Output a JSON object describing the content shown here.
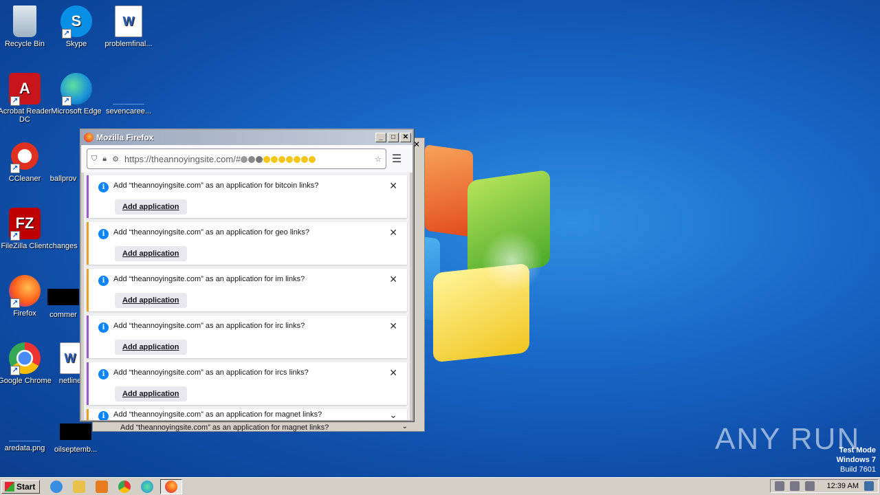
{
  "desktop": {
    "icons": [
      {
        "label": "Recycle Bin"
      },
      {
        "label": "Skype"
      },
      {
        "label": "problemfinal..."
      },
      {
        "label": "Acrobat Reader DC"
      },
      {
        "label": "Microsoft Edge"
      },
      {
        "label": "sevencaree..."
      },
      {
        "label": "CCleaner"
      },
      {
        "label": "ballprov"
      },
      {
        "label": "FileZilla Client"
      },
      {
        "label": "changes"
      },
      {
        "label": "Firefox"
      },
      {
        "label": "commer"
      },
      {
        "label": "Google Chrome"
      },
      {
        "label": "netline"
      },
      {
        "label": "aredata.png"
      },
      {
        "label": "oilseptemb..."
      }
    ]
  },
  "window": {
    "title": "Mozilla Firefox",
    "url": "https://theannoyingsite.com/#",
    "notifications": [
      {
        "message": "Add “theannoyingsite.com” as an application for bitcoin links?",
        "button": "Add application"
      },
      {
        "message": "Add “theannoyingsite.com” as an application for geo links?",
        "button": "Add application"
      },
      {
        "message": "Add “theannoyingsite.com” as an application for im links?",
        "button": "Add application"
      },
      {
        "message": "Add “theannoyingsite.com” as an application for irc links?",
        "button": "Add application"
      },
      {
        "message": "Add “theannoyingsite.com” as an application for ircs links?",
        "button": "Add application"
      },
      {
        "message": "Add “theannoyingsite.com” as an application for magnet links?"
      }
    ],
    "back_window_partial": "Add “theannoyingsite.com” as an application for magnet links?"
  },
  "taskbar": {
    "start_label": "Start",
    "clock": "12:39 AM"
  },
  "watermark": {
    "line1": "Test Mode",
    "line2": "Windows 7",
    "line3": "Build 7601",
    "brand": "ANY RUN"
  },
  "colors": {
    "accent_purple": "#9b59d0",
    "accent_orange": "#e8a020",
    "info_blue": "#0a84ff"
  }
}
